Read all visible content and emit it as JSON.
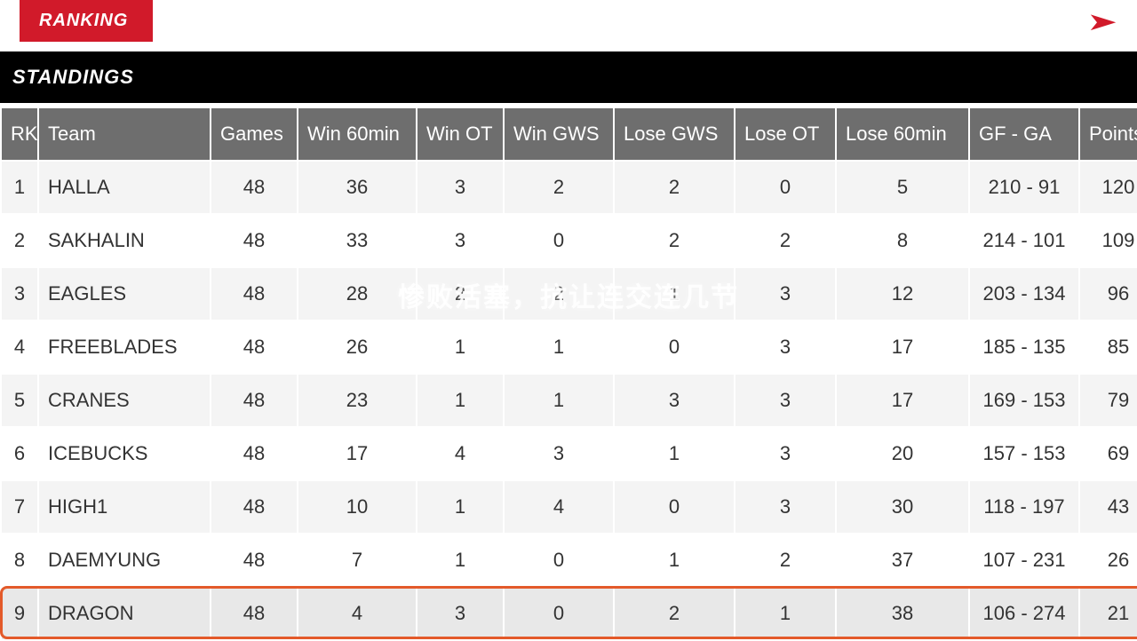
{
  "header": {
    "ranking_label": "RANKING"
  },
  "standings_label": "STANDINGS",
  "columns": {
    "rk": "RK",
    "team": "Team",
    "games": "Games",
    "win60": "Win 60min",
    "winot": "Win OT",
    "wingws": "Win GWS",
    "losegws": "Lose GWS",
    "loseot": "Lose OT",
    "lose60": "Lose 60min",
    "gfga": "GF - GA",
    "points": "Points"
  },
  "rows": [
    {
      "rk": "1",
      "team": "HALLA",
      "games": "48",
      "win60": "36",
      "winot": "3",
      "wingws": "2",
      "losegws": "2",
      "loseot": "0",
      "lose60": "5",
      "gfga": "210 - 91",
      "points": "120"
    },
    {
      "rk": "2",
      "team": "SAKHALIN",
      "games": "48",
      "win60": "33",
      "winot": "3",
      "wingws": "0",
      "losegws": "2",
      "loseot": "2",
      "lose60": "8",
      "gfga": "214 - 101",
      "points": "109"
    },
    {
      "rk": "3",
      "team": "EAGLES",
      "games": "48",
      "win60": "28",
      "winot": "2",
      "wingws": "2",
      "losegws": "1",
      "loseot": "3",
      "lose60": "12",
      "gfga": "203 - 134",
      "points": "96"
    },
    {
      "rk": "4",
      "team": "FREEBLADES",
      "games": "48",
      "win60": "26",
      "winot": "1",
      "wingws": "1",
      "losegws": "0",
      "loseot": "3",
      "lose60": "17",
      "gfga": "185 - 135",
      "points": "85"
    },
    {
      "rk": "5",
      "team": "CRANES",
      "games": "48",
      "win60": "23",
      "winot": "1",
      "wingws": "1",
      "losegws": "3",
      "loseot": "3",
      "lose60": "17",
      "gfga": "169 - 153",
      "points": "79"
    },
    {
      "rk": "6",
      "team": "ICEBUCKS",
      "games": "48",
      "win60": "17",
      "winot": "4",
      "wingws": "3",
      "losegws": "1",
      "loseot": "3",
      "lose60": "20",
      "gfga": "157 - 153",
      "points": "69"
    },
    {
      "rk": "7",
      "team": "HIGH1",
      "games": "48",
      "win60": "10",
      "winot": "1",
      "wingws": "4",
      "losegws": "0",
      "loseot": "3",
      "lose60": "30",
      "gfga": "118 - 197",
      "points": "43"
    },
    {
      "rk": "8",
      "team": "DAEMYUNG",
      "games": "48",
      "win60": "7",
      "winot": "1",
      "wingws": "0",
      "losegws": "1",
      "loseot": "2",
      "lose60": "37",
      "gfga": "107 - 231",
      "points": "26"
    },
    {
      "rk": "9",
      "team": "DRAGON",
      "games": "48",
      "win60": "4",
      "winot": "3",
      "wingws": "0",
      "losegws": "2",
      "loseot": "1",
      "lose60": "38",
      "gfga": "106 - 274",
      "points": "21",
      "highlight": true
    }
  ],
  "overlay_lines": [
    "惨败活塞，抗让连交连几节"
  ],
  "chart_data": {
    "type": "table",
    "title": "STANDINGS",
    "columns": [
      "RK",
      "Team",
      "Games",
      "Win 60min",
      "Win OT",
      "Win GWS",
      "Lose GWS",
      "Lose OT",
      "Lose 60min",
      "GF - GA",
      "Points"
    ],
    "rows": [
      [
        1,
        "HALLA",
        48,
        36,
        3,
        2,
        2,
        0,
        5,
        "210 - 91",
        120
      ],
      [
        2,
        "SAKHALIN",
        48,
        33,
        3,
        0,
        2,
        2,
        8,
        "214 - 101",
        109
      ],
      [
        3,
        "EAGLES",
        48,
        28,
        2,
        2,
        1,
        3,
        12,
        "203 - 134",
        96
      ],
      [
        4,
        "FREEBLADES",
        48,
        26,
        1,
        1,
        0,
        3,
        17,
        "185 - 135",
        85
      ],
      [
        5,
        "CRANES",
        48,
        23,
        1,
        1,
        3,
        3,
        17,
        "169 - 153",
        79
      ],
      [
        6,
        "ICEBUCKS",
        48,
        17,
        4,
        3,
        1,
        3,
        20,
        "157 - 153",
        69
      ],
      [
        7,
        "HIGH1",
        48,
        10,
        1,
        4,
        0,
        3,
        30,
        "118 - 197",
        43
      ],
      [
        8,
        "DAEMYUNG",
        48,
        7,
        1,
        0,
        1,
        2,
        37,
        "107 - 231",
        26
      ],
      [
        9,
        "DRAGON",
        48,
        4,
        3,
        0,
        2,
        1,
        38,
        "106 - 274",
        21
      ]
    ]
  }
}
